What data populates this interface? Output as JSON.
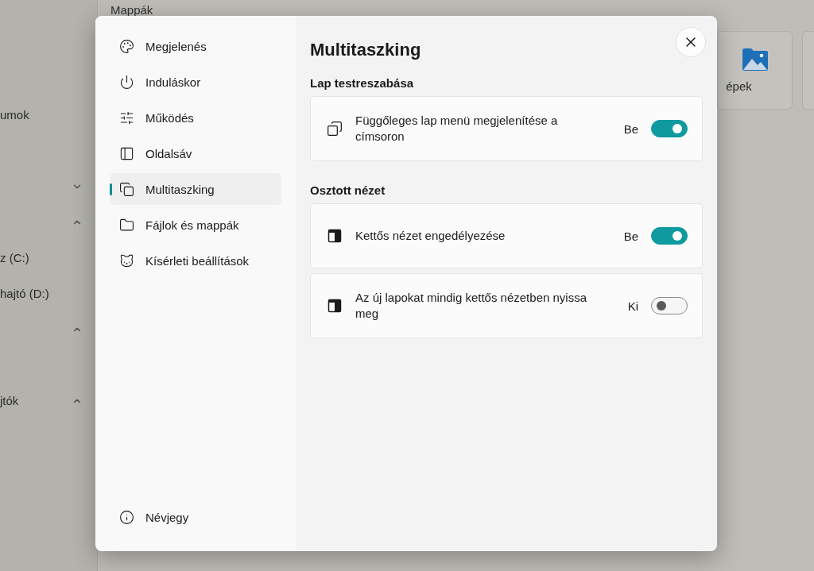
{
  "background": {
    "section_title": "Mappák",
    "sidebar": [
      {
        "label": "umok"
      },
      {
        "expanded": false
      },
      {
        "expanded": true
      },
      {
        "label": "z (C:)"
      },
      {
        "label": "hajtó (D:)"
      },
      {
        "expanded": true
      },
      {
        "label": "jtók",
        "expanded": true
      }
    ],
    "tiles": [
      {
        "label": "épek"
      }
    ]
  },
  "dialog": {
    "nav": [
      {
        "label": "Megjelenés",
        "selected": false
      },
      {
        "label": "Induláskor",
        "selected": false
      },
      {
        "label": "Működés",
        "selected": false
      },
      {
        "label": "Oldalsáv",
        "selected": false
      },
      {
        "label": "Multitaszking",
        "selected": true
      },
      {
        "label": "Fájlok és mappák",
        "selected": false
      },
      {
        "label": "Kísérleti beállítások",
        "selected": false
      }
    ],
    "footer_item": {
      "label": "Névjegy"
    },
    "title": "Multitaszking",
    "sections": [
      {
        "title": "Lap testreszabása",
        "settings": [
          {
            "label": "Függőleges lap menü megjelenítése a címsoron",
            "state_label": "Be",
            "on": true
          }
        ]
      },
      {
        "title": "Osztott nézet",
        "settings": [
          {
            "label": "Kettős nézet engedélyezése",
            "state_label": "Be",
            "on": true
          },
          {
            "label": "Az új lapokat mindig kettős nézetben nyissa meg",
            "state_label": "Ki",
            "on": false
          }
        ]
      }
    ]
  }
}
